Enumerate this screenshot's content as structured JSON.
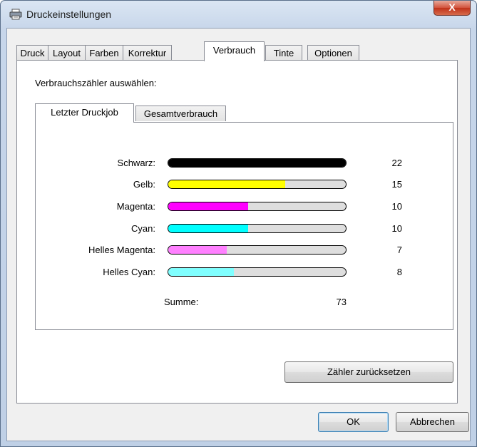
{
  "window": {
    "title": "Druckeinstellungen",
    "close_label": "X"
  },
  "tabs": [
    {
      "label": "Druck"
    },
    {
      "label": "Layout"
    },
    {
      "label": "Farben"
    },
    {
      "label": "Korrektur"
    },
    {
      "label": "Verbrauch",
      "active": true
    },
    {
      "label": "Tinte"
    },
    {
      "label": "Optionen"
    }
  ],
  "consumption": {
    "section_label": "Verbrauchszähler auswählen:",
    "subtabs": [
      {
        "label": "Letzter Druckjob",
        "active": true
      },
      {
        "label": "Gesamtverbrauch"
      }
    ],
    "rows": [
      {
        "label": "Schwarz:",
        "count": "22",
        "fill": 1.0,
        "color": "#000000"
      },
      {
        "label": "Gelb:",
        "count": "15",
        "fill": 0.66,
        "color": "#ffff00"
      },
      {
        "label": "Magenta:",
        "count": "10",
        "fill": 0.45,
        "color": "#ff00ff"
      },
      {
        "label": "Cyan:",
        "count": "10",
        "fill": 0.45,
        "color": "#00ffff"
      },
      {
        "label": "Helles Magenta:",
        "count": "7",
        "fill": 0.33,
        "color": "#ff80ff"
      },
      {
        "label": "Helles Cyan:",
        "count": "8",
        "fill": 0.37,
        "color": "#80ffff"
      }
    ],
    "sum_label": "Summe:",
    "sum_value": "73"
  },
  "buttons": {
    "reset": "Zähler zurücksetzen",
    "ok": "OK",
    "cancel": "Abbrechen"
  }
}
